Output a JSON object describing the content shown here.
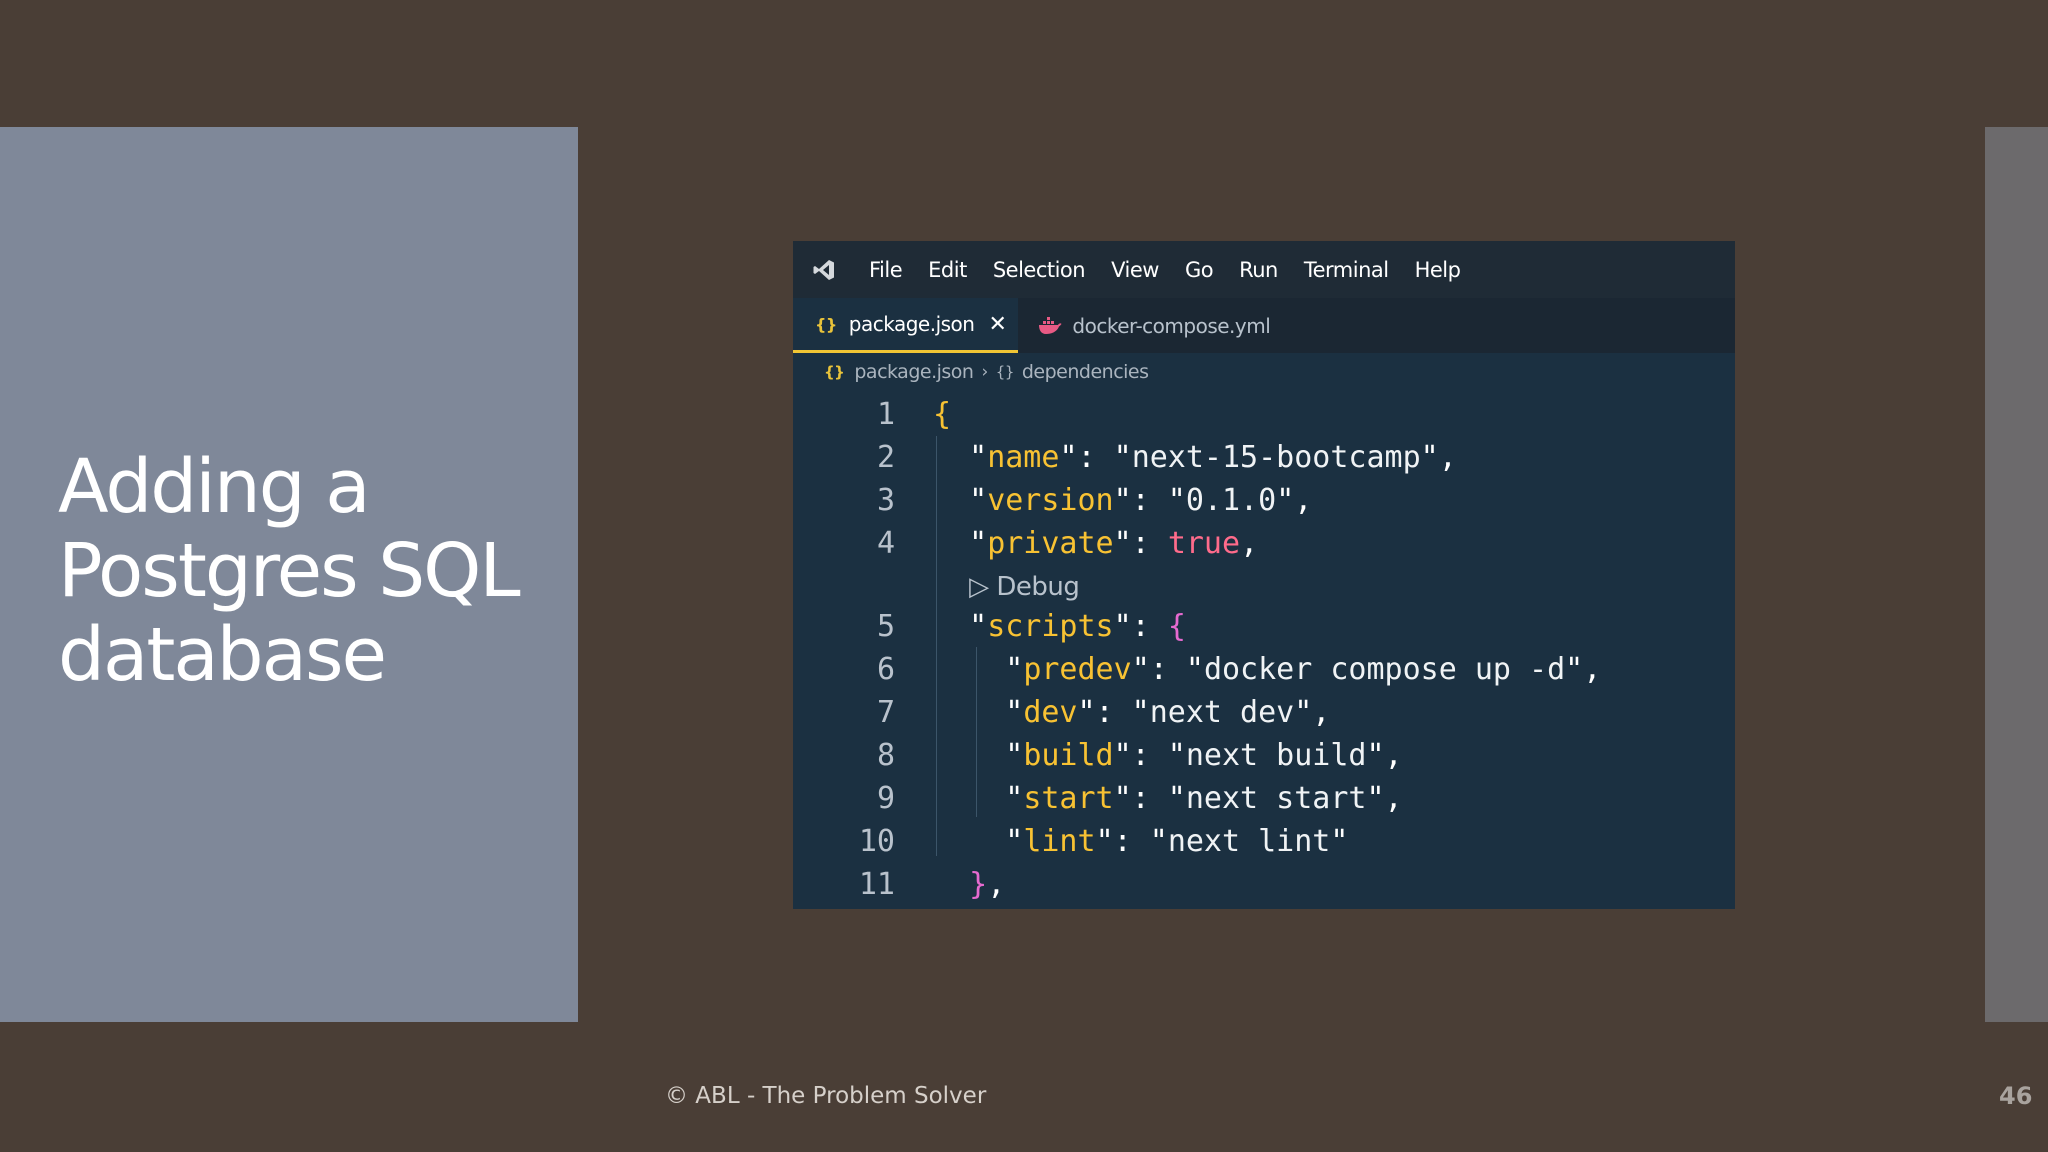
{
  "slide": {
    "title_lines": [
      "Adding a",
      "Postgres SQL",
      "database"
    ],
    "footer": "© ABL - The Problem Solver",
    "page_number": "46"
  },
  "editor": {
    "menu": [
      "File",
      "Edit",
      "Selection",
      "View",
      "Go",
      "Run",
      "Terminal",
      "Help"
    ],
    "tabs": [
      {
        "label": "package.json",
        "icon": "json-braces-icon",
        "active": true,
        "close": "✕"
      },
      {
        "label": "docker-compose.yml",
        "icon": "docker-whale-icon",
        "active": false
      }
    ],
    "breadcrumb": {
      "file": "package.json",
      "symbol": "dependencies"
    },
    "codelens": "Debug",
    "lines": [
      {
        "n": "1"
      },
      {
        "n": "2",
        "key": "name",
        "value": "next-15-bootcamp"
      },
      {
        "n": "3",
        "key": "version",
        "value": "0.1.0"
      },
      {
        "n": "4",
        "key": "private",
        "value": "true"
      },
      {
        "n": "5",
        "key": "scripts"
      },
      {
        "n": "6",
        "key": "predev",
        "value": "docker compose up -d"
      },
      {
        "n": "7",
        "key": "dev",
        "value": "next dev"
      },
      {
        "n": "8",
        "key": "build",
        "value": "next build"
      },
      {
        "n": "9",
        "key": "start",
        "value": "next start"
      },
      {
        "n": "10",
        "key": "lint",
        "value": "next lint"
      },
      {
        "n": "11"
      }
    ]
  },
  "colors": {
    "background": "#4a3e36",
    "title_panel": "#7f8899",
    "editor_bg": "#1b3041",
    "json_key": "#f8c233",
    "boolean": "#ff6b8b",
    "tab_accent": "#f0c534"
  }
}
